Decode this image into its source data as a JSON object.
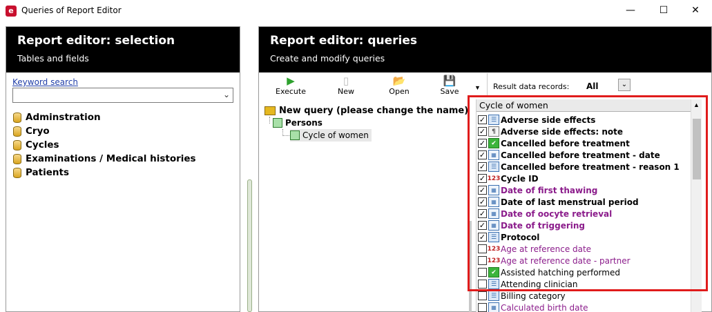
{
  "window": {
    "title": "Queries of Report Editor",
    "app_icon_glyph": "e",
    "minimize_glyph": "—",
    "maximize_glyph": "☐",
    "close_glyph": "✕"
  },
  "left_panel": {
    "title": "Report editor: selection",
    "subtitle": "Tables and fields",
    "keyword_label": "Keyword search",
    "keyword_value": "",
    "combo_arrow": "⌄",
    "items": [
      {
        "label": "Adminstration",
        "icon": "database-icon"
      },
      {
        "label": "Cryo",
        "icon": "database-icon"
      },
      {
        "label": "Cycles",
        "icon": "database-icon"
      },
      {
        "label": "Examinations / Medical histories",
        "icon": "database-icon"
      },
      {
        "label": "Patients",
        "icon": "database-icon"
      }
    ]
  },
  "right_panel": {
    "title": "Report editor: queries",
    "subtitle": "Create and modify queries",
    "toolbar": {
      "execute": {
        "label": "Execute",
        "glyph": "▶",
        "icon": "play-icon"
      },
      "new": {
        "label": "New",
        "glyph": "▯",
        "icon": "new-document-icon"
      },
      "open": {
        "label": "Open",
        "glyph": "📂",
        "icon": "open-folder-icon"
      },
      "save": {
        "label": "Save",
        "glyph": "💾",
        "icon": "save-disk-icon"
      },
      "overflow_glyph": "▼"
    },
    "result_records": {
      "label": "Result data records:",
      "value": "All",
      "arrow": "⌄"
    },
    "query_tree": {
      "root": "New query (please change the name)",
      "persons": "Persons",
      "cycle": "Cycle of women"
    },
    "fields_list": {
      "header": "Cycle of women",
      "scroll_up_glyph": "▲",
      "fields": [
        {
          "label": "Adverse side effects",
          "checked": true,
          "icon_type": "list",
          "style": "bold"
        },
        {
          "label": "Adverse side effects: note",
          "checked": true,
          "icon_type": "note",
          "style": "bold"
        },
        {
          "label": "Cancelled before treatment",
          "checked": true,
          "icon_type": "check",
          "style": "bold"
        },
        {
          "label": "Cancelled before treatment - date",
          "checked": true,
          "icon_type": "date",
          "style": "bold"
        },
        {
          "label": "Cancelled before treatment - reason 1",
          "checked": true,
          "icon_type": "list",
          "style": "bold"
        },
        {
          "label": "Cycle ID",
          "checked": true,
          "icon_type": "number",
          "style": "bold"
        },
        {
          "label": "Date of first thawing",
          "checked": true,
          "icon_type": "date",
          "style": "bold-purple"
        },
        {
          "label": "Date of last menstrual period",
          "checked": true,
          "icon_type": "date",
          "style": "bold"
        },
        {
          "label": "Date of oocyte retrieval",
          "checked": true,
          "icon_type": "date",
          "style": "bold-purple"
        },
        {
          "label": "Date of triggering",
          "checked": true,
          "icon_type": "date",
          "style": "bold-purple"
        },
        {
          "label": "Protocol",
          "checked": true,
          "icon_type": "list",
          "style": "bold"
        },
        {
          "label": "Age at reference date",
          "checked": false,
          "icon_type": "number",
          "style": "purple"
        },
        {
          "label": "Age at reference date - partner",
          "checked": false,
          "icon_type": "number",
          "style": "purple"
        },
        {
          "label": "Assisted hatching performed",
          "checked": false,
          "icon_type": "check",
          "style": "normal"
        },
        {
          "label": "Attending clinician",
          "checked": false,
          "icon_type": "list",
          "style": "normal"
        },
        {
          "label": "Billing category",
          "checked": false,
          "icon_type": "list",
          "style": "normal"
        },
        {
          "label": "Calculated birth date",
          "checked": false,
          "icon_type": "date",
          "style": "purple"
        }
      ]
    }
  },
  "colors": {
    "highlight": "#e01b1b",
    "header_bg": "#000000",
    "link_blue": "#1f3da8",
    "purple_text": "#8b1c8b"
  }
}
